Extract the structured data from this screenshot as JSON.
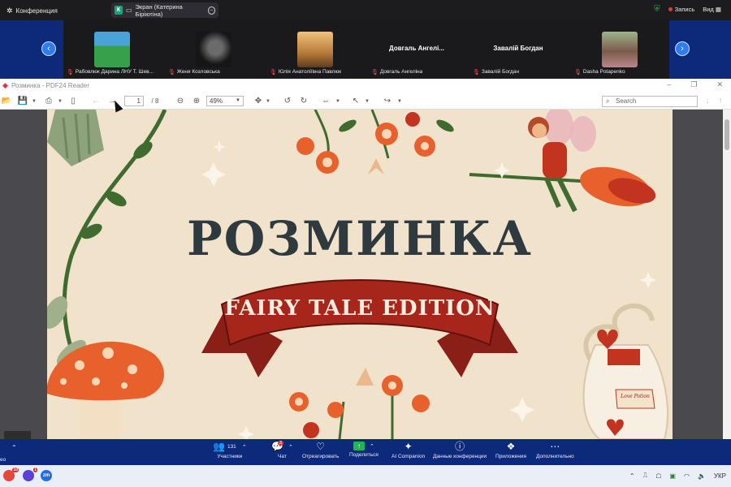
{
  "topbar": {
    "app_title": "Конференция",
    "share_badge": "К",
    "share_label": "Экран (Катерина Біріютіна)",
    "record_label": "Запись",
    "view_label": "Вид"
  },
  "participants": [
    {
      "name": "Рабовлюк Дарина ЛНУ Т. Шев...",
      "has_photo": true,
      "photo_color": "#3c9a5a",
      "muted": true
    },
    {
      "name": "Женя Козловська",
      "has_photo": true,
      "photo_color": "#2a2a2a",
      "muted": true
    },
    {
      "name": "Юлія Анатоліївна Павлюк",
      "has_photo": true,
      "photo_color": "#c9a064",
      "muted": true
    },
    {
      "name": "Довгаль Ангеліна",
      "has_photo": false,
      "display_name": "Довгаль Ангелі...",
      "muted": true
    },
    {
      "name": "Завалій Богдан",
      "has_photo": false,
      "display_name": "Завалій Богдан",
      "muted": true
    },
    {
      "name": "Dasha Potapenko",
      "has_photo": true,
      "photo_color": "#8fa27a",
      "muted": true
    }
  ],
  "pdf": {
    "window_title": "Розминка - PDF24 Reader",
    "current_page": "1",
    "total_pages": "/ 8",
    "zoom": "49%",
    "search_placeholder": "Search"
  },
  "slide": {
    "title": "РОЗМИНКА",
    "ribbon_text": "FAIRY TALE EDITION",
    "bottle_label": "Love Potion",
    "colors": {
      "bg": "#f1e2cc",
      "ribbon": "#a7261c",
      "title": "#2f3a3f",
      "orange": "#e8612c",
      "green": "#3f6b2f"
    }
  },
  "meeting_toolbar": {
    "participants_count": "131",
    "participants_label": "Участники",
    "chat_badge": "3",
    "chat_label": "Чат",
    "react_label": "Отреагировать",
    "share_label": "Поделиться",
    "ai_label": "AI Companion",
    "info_label": "Данные конференции",
    "apps_label": "Приложения",
    "more_label": "Дополнительно",
    "left_cut_label": "ео"
  },
  "taskbar": {
    "badge_1": "10",
    "badge_2": "1",
    "zoom_label": "zm",
    "lang": "УКР"
  }
}
